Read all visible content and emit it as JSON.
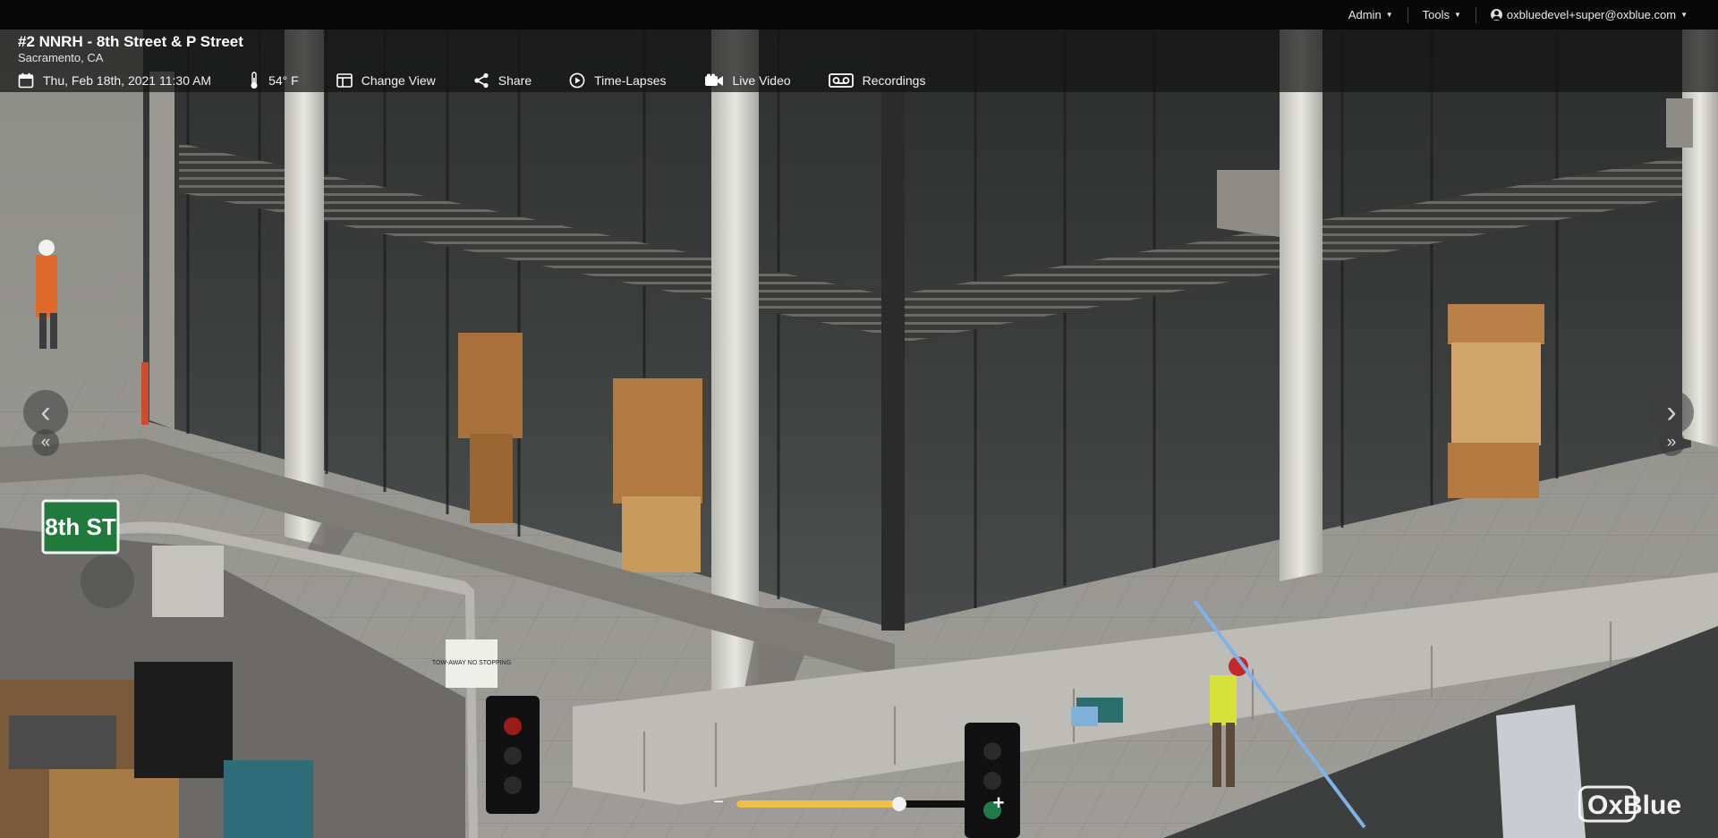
{
  "top_nav": {
    "admin_label": "Admin",
    "tools_label": "Tools",
    "user_email": "oxbluedevel+super@oxblue.com"
  },
  "camera": {
    "title": "#2 NNRH - 8th Street & P Street",
    "location": "Sacramento, CA",
    "datetime": "Thu, Feb 18th, 2021 11:30 AM",
    "temperature": "54° F"
  },
  "toolbar": {
    "change_view_label": "Change View",
    "share_label": "Share",
    "timelapses_label": "Time-Lapses",
    "live_video_label": "Live Video",
    "recordings_label": "Recordings"
  },
  "scene": {
    "street_sign": "8th ST",
    "parking_sign": "TOW-AWAY NO STOPPING"
  },
  "zoom": {
    "minus": "−",
    "plus": "+",
    "level": 0.67
  },
  "logo": {
    "text": "OxBlue"
  },
  "icons": {
    "calendar": "calendar-icon",
    "thermometer": "thermometer-icon",
    "change_view": "layout-icon",
    "share": "share-icon",
    "timelapses": "play-circle-icon",
    "live_video": "video-camera-icon",
    "recordings": "vhs-tape-icon"
  },
  "colors": {
    "topbar_bg": "#080808",
    "zoom_fill": "#f0bf4a",
    "sign_green": "#1f7a3c"
  }
}
